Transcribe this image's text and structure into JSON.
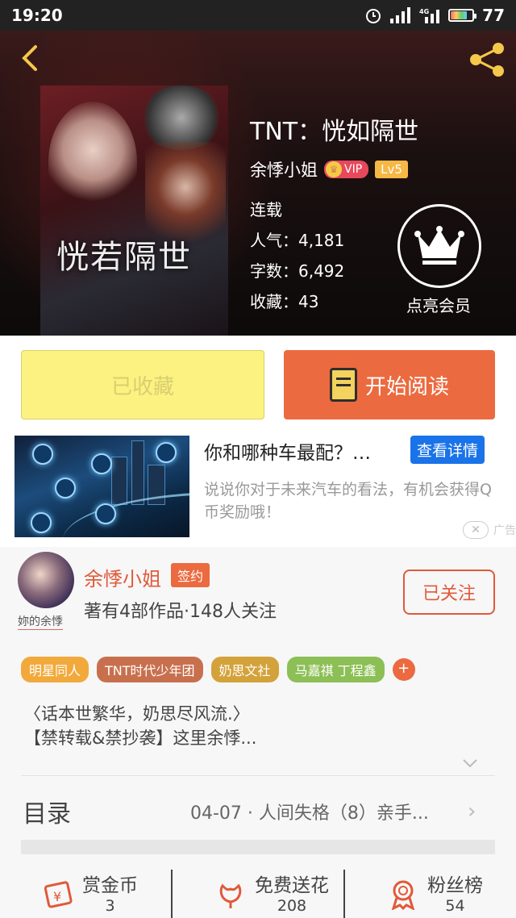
{
  "status_bar": {
    "time": "19:20",
    "battery": "77",
    "battery_level": 0.77,
    "network": "4G"
  },
  "book": {
    "title": "TNT：恍如隔世",
    "cover_title": "恍若隔世",
    "author": "余悸小姐",
    "vip": "VIP",
    "level": "Lv5",
    "status": "连载",
    "popularity": "人气：4,181",
    "words": "字数：6,492",
    "favorites": "收藏：43"
  },
  "member": {
    "label": "点亮会员"
  },
  "actions": {
    "collected": "已收藏",
    "read": "开始阅读"
  },
  "ad": {
    "title": "你和哪种车最配？…",
    "detail": "查看详情",
    "desc": "说说你对于未来汽车的看法，有机会获得Q币奖励哦！",
    "tag": "广告"
  },
  "author_card": {
    "name": "余悸小姐",
    "sign": "签约",
    "caption": "妳的余悸",
    "stats": "著有4部作品·148人关注",
    "follow": "已关注"
  },
  "tags": [
    {
      "label": "明星同人",
      "color": "#f2a93b"
    },
    {
      "label": "TNT时代少年团",
      "color": "#c8704e"
    },
    {
      "label": "奶思文社",
      "color": "#d4a23a"
    },
    {
      "label": "马嘉祺 丁程鑫",
      "color": "#8cbf55"
    }
  ],
  "intro": {
    "line1": "〈话本世繁华，奶思尽风流.〉",
    "line2": "【禁转载&禁抄袭】这里余悸..."
  },
  "toc": {
    "label": "目录",
    "latest": "04-07 · 人间失格（8）亲手..."
  },
  "bottom": [
    {
      "label": "赏金币",
      "value": "3",
      "icon": "coin-icon"
    },
    {
      "label": "免费送花",
      "value": "208",
      "icon": "flower-icon"
    },
    {
      "label": "粉丝榜",
      "value": "54",
      "icon": "medal-icon"
    }
  ]
}
